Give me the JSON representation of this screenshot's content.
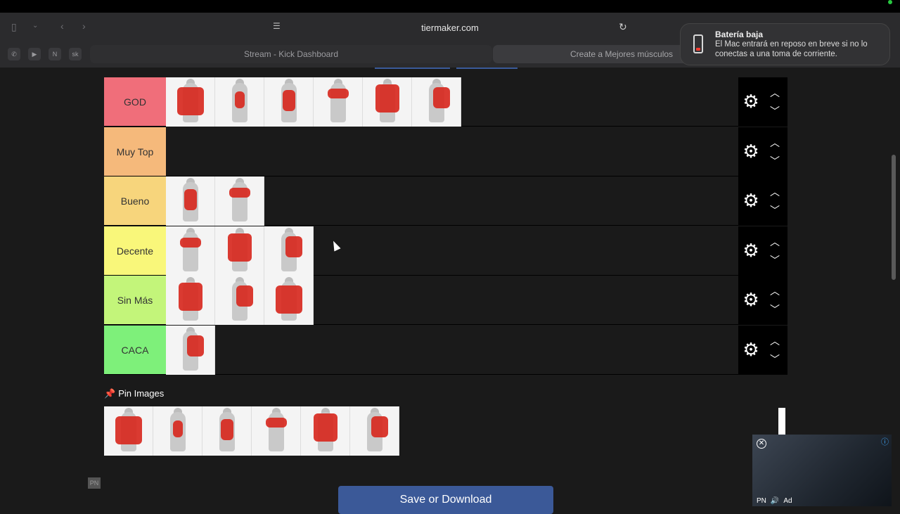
{
  "browser": {
    "url": "tiermaker.com",
    "tabs": [
      {
        "label": "Stream - Kick Dashboard"
      },
      {
        "label": "Create a Mejores músculos"
      }
    ],
    "pinned_tabs": [
      "whatsapp",
      "youtube",
      "notion",
      "sk"
    ]
  },
  "notification": {
    "title": "Batería baja",
    "body": "El Mac entrará en reposo en breve si no lo conectas a una toma de corriente."
  },
  "tiers": [
    {
      "label": "GOD",
      "color": "#f06e7a",
      "items": 6
    },
    {
      "label": "Muy Top",
      "color": "#f5b97b",
      "items": 0
    },
    {
      "label": "Bueno",
      "color": "#f7d57c",
      "items": 2
    },
    {
      "label": "Decente",
      "color": "#f9f77a",
      "items": 3
    },
    {
      "label": "Sin Más",
      "color": "#c3f57a",
      "items": 3
    },
    {
      "label": "CACA",
      "color": "#7ef07a",
      "items": 1
    }
  ],
  "pin_section": {
    "label": "Pin Images",
    "items": 6
  },
  "save_button": "Save or Download",
  "ad": {
    "label": "Ad"
  },
  "misc": {
    "pn": "PN"
  }
}
